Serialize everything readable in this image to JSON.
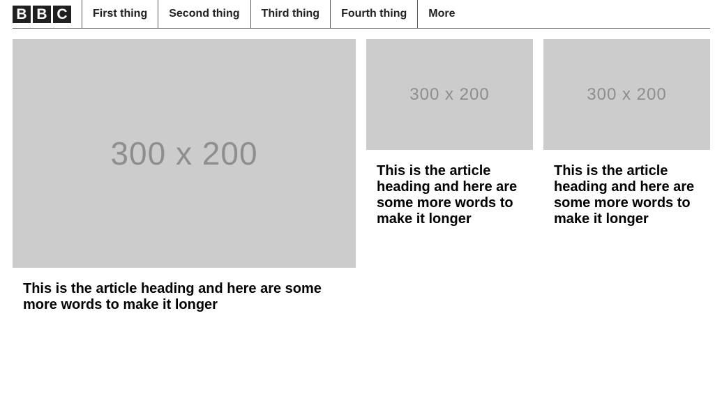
{
  "header": {
    "logo_letters": [
      "B",
      "B",
      "C"
    ],
    "nav_items": [
      {
        "label": "First thing"
      },
      {
        "label": "Second thing"
      },
      {
        "label": "Third thing"
      },
      {
        "label": "Fourth thing"
      },
      {
        "label": "More"
      }
    ]
  },
  "articles": [
    {
      "image_placeholder": "300 x 200",
      "heading": "This is the article heading and here are some more words to make it longer"
    },
    {
      "image_placeholder": "300 x 200",
      "heading": "This is the article heading and here are some more words to make it longer"
    },
    {
      "image_placeholder": "300 x 200",
      "heading": "This is the article heading and here are some more words to make it longer"
    }
  ],
  "colors": {
    "placeholder_bg": "#cccccc",
    "placeholder_text": "#8e8e8e",
    "divider": "#5a5a5a",
    "logo_block": "#202020"
  }
}
